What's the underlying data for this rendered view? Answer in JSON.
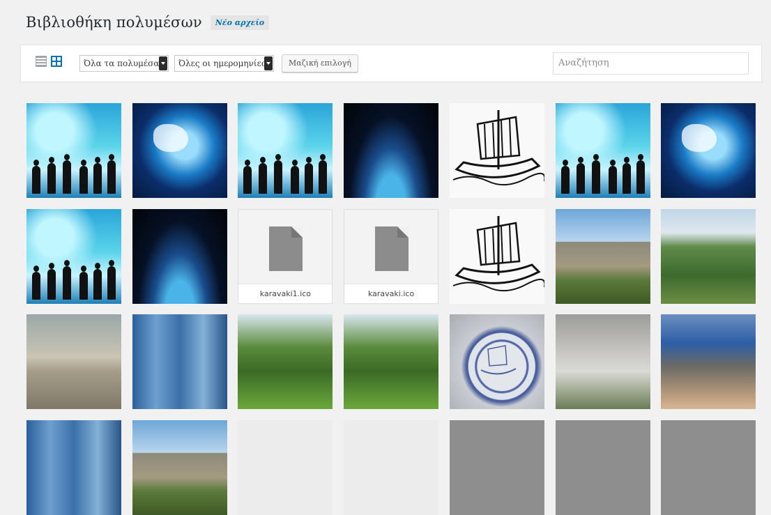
{
  "header": {
    "title": "Βιβλιοθήκη πολυμέσων",
    "add_new": "Νέο αρχείο"
  },
  "toolbar": {
    "view_list_icon": "list-view-icon",
    "view_grid_icon": "grid-view-icon",
    "filter_type": "Όλα τα πολυμέσα",
    "filter_date": "Όλες οι ημερομηνίες",
    "bulk_select": "Μαζική επιλογή",
    "search_placeholder": "Αναζήτηση"
  },
  "media": [
    {
      "kind": "people",
      "caption": ""
    },
    {
      "kind": "globe",
      "caption": ""
    },
    {
      "kind": "people",
      "caption": ""
    },
    {
      "kind": "night",
      "caption": ""
    },
    {
      "kind": "ship",
      "caption": ""
    },
    {
      "kind": "people",
      "caption": ""
    },
    {
      "kind": "globe",
      "caption": ""
    },
    {
      "kind": "people",
      "caption": ""
    },
    {
      "kind": "night",
      "caption": ""
    },
    {
      "kind": "file",
      "caption": "karavaki1.ico"
    },
    {
      "kind": "file",
      "caption": "karavaki.ico"
    },
    {
      "kind": "ship",
      "caption": ""
    },
    {
      "kind": "building",
      "caption": ""
    },
    {
      "kind": "trees",
      "caption": ""
    },
    {
      "kind": "stairs",
      "caption": ""
    },
    {
      "kind": "glass",
      "caption": ""
    },
    {
      "kind": "park",
      "caption": ""
    },
    {
      "kind": "park",
      "caption": ""
    },
    {
      "kind": "seal",
      "caption": ""
    },
    {
      "kind": "sign",
      "caption": ""
    },
    {
      "kind": "entry",
      "caption": ""
    },
    {
      "kind": "glass",
      "caption": ""
    },
    {
      "kind": "building",
      "caption": ""
    },
    {
      "kind": "light",
      "caption": ""
    },
    {
      "kind": "light",
      "caption": ""
    },
    {
      "kind": "gray",
      "caption": ""
    },
    {
      "kind": "gray",
      "caption": ""
    },
    {
      "kind": "gray",
      "caption": ""
    }
  ]
}
